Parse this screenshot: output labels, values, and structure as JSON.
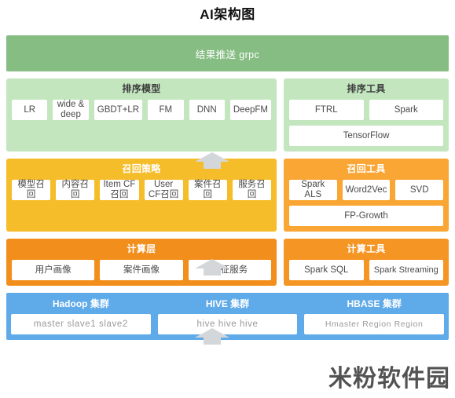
{
  "page": {
    "title": "AI架构图",
    "watermark": "米粉软件园"
  },
  "colors": {
    "banner_green": "#86bd83",
    "panel_light_green": "#c3e6bf",
    "recall_amber": "#f6bd2a",
    "recall_tool_orange": "#f9a634",
    "compute_orange": "#f28f1c",
    "cluster_blue": "#5faae9",
    "arrow_gray": "#d4d7da",
    "cell_white": "#ffffff"
  },
  "banner": {
    "label": "结果推送 grpc"
  },
  "rank_row": {
    "left": {
      "title": "排序模型",
      "cells": [
        "LR",
        "wide & deep",
        "GBDT+LR",
        "FM",
        "DNN",
        "DeepFM"
      ]
    },
    "right": {
      "title": "排序工具",
      "cells": [
        "FTRL",
        "Spark"
      ],
      "wide_cell": "TensorFlow"
    }
  },
  "recall_row": {
    "left": {
      "title": "召回策略",
      "cells": [
        "模型召回",
        "内容召回",
        "Item CF 召回",
        "User CF召回",
        "案件召回",
        "服务召回"
      ]
    },
    "right": {
      "title": "召回工具",
      "cells": [
        "Spark ALS",
        "Word2Vec",
        "SVD",
        "FP-Growth"
      ]
    }
  },
  "compute_row": {
    "left": {
      "title": "计算层",
      "cells": [
        "用户画像",
        "案件画像",
        "特征服务"
      ]
    },
    "right": {
      "title": "计算工具",
      "cells": [
        "Spark SQL",
        "Spark Streaming"
      ]
    }
  },
  "clusters": [
    {
      "title": "Hadoop 集群",
      "nodes": "master  slave1   slave2"
    },
    {
      "title": "HIVE 集群",
      "nodes": "hive   hive   hive"
    },
    {
      "title": "HBASE 集群",
      "nodes": "Hmaster  Region Region"
    }
  ],
  "arrows": [
    {
      "name": "arrow-recall-to-rank"
    },
    {
      "name": "arrow-compute-to-recall"
    },
    {
      "name": "arrow-cluster-to-compute"
    }
  ]
}
